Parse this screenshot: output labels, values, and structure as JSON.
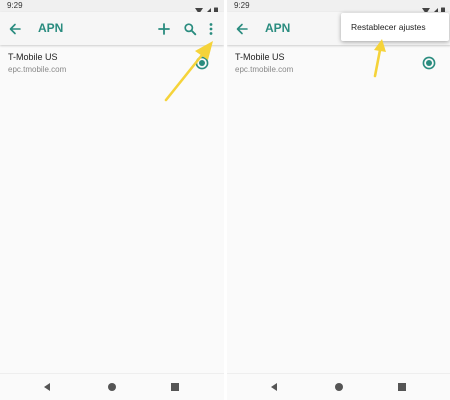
{
  "colors": {
    "accent": "#2a8c7f",
    "arrow": "#f5d33a",
    "background": "#fafafa",
    "app_bar": "#f6f6f6"
  },
  "status_bar": {
    "time": "9:29",
    "icons": [
      "wifi-icon",
      "signal-icon",
      "battery-icon"
    ]
  },
  "app_bar": {
    "title": "APN",
    "icons": [
      "back-arrow-icon",
      "plus-icon",
      "search-icon",
      "more-vert-icon"
    ]
  },
  "apn_list": [
    {
      "name": "T-Mobile US",
      "apn": "epc.tmobile.com",
      "selected": true
    }
  ],
  "overflow_menu": {
    "items": [
      "Restablecer ajustes"
    ]
  },
  "nav_bar": {
    "icons": [
      "nav-back-icon",
      "nav-home-icon",
      "nav-recents-icon"
    ]
  }
}
